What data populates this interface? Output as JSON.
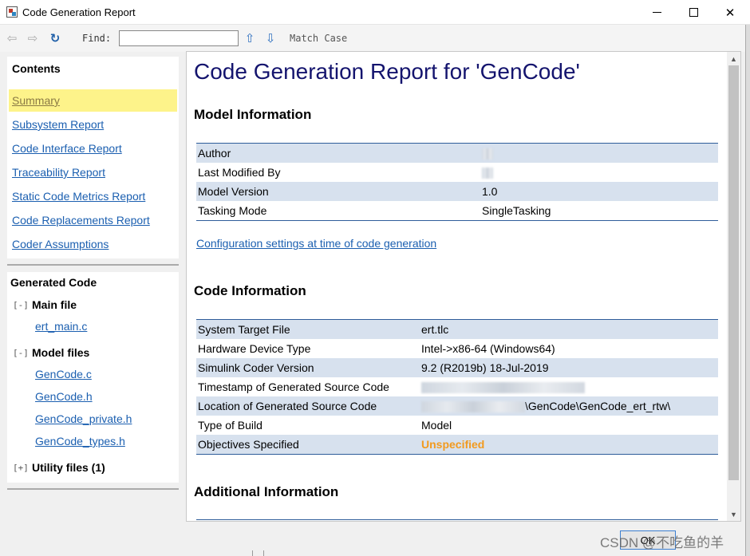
{
  "window": {
    "title": "Code Generation Report"
  },
  "toolbar": {
    "find_label": "Find:",
    "find_value": "",
    "match_case": "Match Case"
  },
  "sidebar": {
    "contents_title": "Contents",
    "links": [
      "Summary",
      "Subsystem Report",
      "Code Interface Report",
      "Traceability Report",
      "Static Code Metrics Report",
      "Code Replacements Report",
      "Coder Assumptions"
    ],
    "generated_code_title": "Generated Code",
    "groups": [
      {
        "toggle": "[-]",
        "label": "Main file",
        "files": [
          "ert_main.c"
        ]
      },
      {
        "toggle": "[-]",
        "label": "Model files",
        "files": [
          "GenCode.c",
          "GenCode.h",
          "GenCode_private.h",
          "GenCode_types.h"
        ]
      },
      {
        "toggle": "[+]",
        "label": "Utility files (1)",
        "files": []
      }
    ]
  },
  "report": {
    "title": "Code Generation Report for 'GenCode'",
    "model_info_heading": "Model Information",
    "model_info": [
      {
        "key": "Author",
        "value": ""
      },
      {
        "key": "Last Modified By",
        "value": ""
      },
      {
        "key": "Model Version",
        "value": "1.0"
      },
      {
        "key": "Tasking Mode",
        "value": "SingleTasking"
      }
    ],
    "config_link": "Configuration settings at time of code generation",
    "code_info_heading": "Code Information",
    "code_info": [
      {
        "key": "System Target File",
        "value": "ert.tlc"
      },
      {
        "key": "Hardware Device Type",
        "value": "Intel->x86-64 (Windows64)"
      },
      {
        "key": "Simulink Coder Version",
        "value": "9.2 (R2019b) 18-Jul-2019"
      },
      {
        "key": "Timestamp of Generated Source Code",
        "value": ""
      },
      {
        "key": "Location of Generated Source Code",
        "value": "\\GenCode\\GenCode_ert_rtw\\"
      },
      {
        "key": "Type of Build",
        "value": "Model"
      },
      {
        "key": "Objectives Specified",
        "value": "Unspecified"
      }
    ],
    "additional_heading": "Additional Information"
  },
  "footer": {
    "ok_label": "OK",
    "watermark": "CSDN @不吃鱼的羊"
  },
  "colors": {
    "link": "#1b5fb0",
    "title": "#14146e",
    "row_shade": "#d7e1ee",
    "highlight": "#fdf38a",
    "objective": "#f29a1e"
  },
  "icons": [
    "back-arrow-icon",
    "forward-arrow-icon",
    "refresh-icon",
    "find-up-icon",
    "find-down-icon",
    "close-icon",
    "minimize-icon",
    "maximize-icon"
  ]
}
